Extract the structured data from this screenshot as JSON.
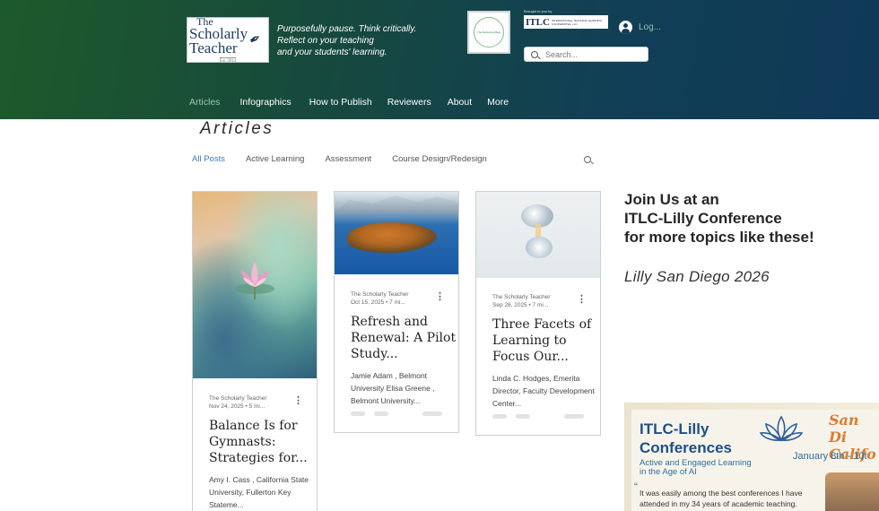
{
  "header": {
    "logo": {
      "line1": "The",
      "line2": "Scholarly Teacher",
      "line3": "Est. 2014"
    },
    "tagline": [
      "Purposefully pause.  Think critically.",
      "Reflect on your teaching",
      "and your students' learning."
    ],
    "badge_text": "The Reflective Blog",
    "brought_by": "Brought to you by",
    "itlc_logo": {
      "big": "ITLC",
      "small": "INTERNATIONAL TEACHING LEARNING COOPERATIVE, LLC"
    },
    "login_label": "Log...",
    "search_placeholder": "Search...",
    "nav": [
      "Articles",
      "Infographics",
      "How to Publish",
      "Reviewers",
      "About",
      "More"
    ]
  },
  "blog": {
    "page_title": "Articles",
    "categories": [
      "All Posts",
      "Active Learning",
      "Assessment",
      "Course Design/Redesign"
    ],
    "posts": [
      {
        "author": "The Scholarly Teacher",
        "date_read": "Nov 24, 2025  •  5 mi...",
        "title": "Balance Is for Gymnasts: Strategies for...",
        "excerpt": "Amy I. Cass , California State University, Fullerton Key Stateme..."
      },
      {
        "author": "The Scholarly Teacher",
        "date_read": "Oct 15, 2025  •  7 mi...",
        "title": "Refresh and Renewal: A Pilot Study...",
        "excerpt": "Jamie Adam , Belmont University Elisa Greene , Belmont University..."
      },
      {
        "author": "The Scholarly Teacher",
        "date_read": "Sep 26, 2025  •  7 mi...",
        "title": "Three Facets of Learning to Focus Our...",
        "excerpt": "Linda C. Hodges, Emerita Director, Faculty Development Center..."
      }
    ]
  },
  "promo": {
    "lines": [
      "Join Us at an",
      "ITLC-Lilly Conference",
      "for more topics like these!"
    ],
    "event": "Lilly San Diego 2026",
    "banner": {
      "title_lines": [
        "ITLC-Lilly",
        "Conferences"
      ],
      "subtitle_lines": [
        "Active and Engaged Learning",
        "in the Age of AI"
      ],
      "date": "January  8th - 10t",
      "city_lines": [
        "San Di",
        "Califo"
      ],
      "quote": "It was easily among the best conferences I have attended in my 34 years of academic teaching."
    }
  }
}
